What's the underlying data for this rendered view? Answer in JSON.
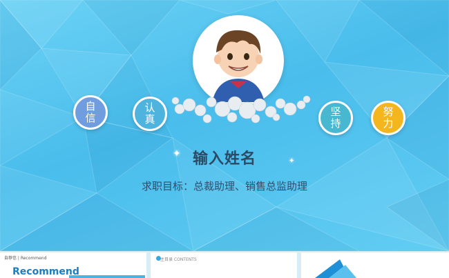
{
  "avatar": {
    "name": "cartoon-boy"
  },
  "traits": [
    {
      "line1": "自",
      "line2": "信",
      "color": "#6f9de0"
    },
    {
      "line1": "认",
      "line2": "真",
      "color": "#4fb4dd"
    },
    {
      "line1": "坚",
      "line2": "持",
      "color": "#47b8cf"
    },
    {
      "line1": "努",
      "line2": "力",
      "color": "#f4b61f"
    }
  ],
  "name_placeholder": "输入姓名",
  "goal": "求职目标：总裁助理、销售总监助理",
  "thumbnails": [
    {
      "header": "自荐信 | Recommend",
      "title": "Recommend"
    },
    {
      "header": "主目录 CONTENTS",
      "title": ""
    },
    {
      "header": "",
      "title": ""
    }
  ],
  "colors": {
    "background": "#5cc6ef",
    "accent": "#1a7fc2"
  }
}
